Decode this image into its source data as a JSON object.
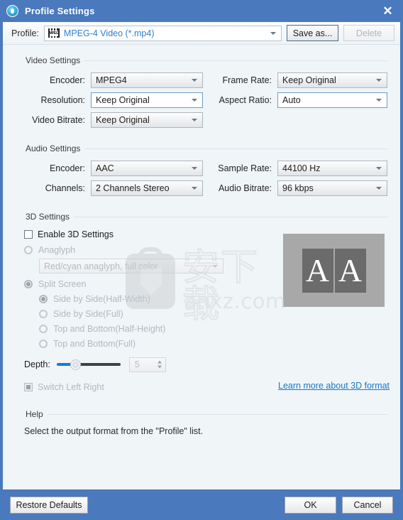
{
  "window": {
    "title": "Profile Settings",
    "app_icon": "profile-circle-icon",
    "close_icon": "✕",
    "titlebar_color": "#4a79bd",
    "background_color": "#f0f5f8"
  },
  "profile_bar": {
    "label": "Profile:",
    "format_icon": "mpeg-film-icon",
    "selected_profile": "MPEG-4 Video (*.mp4)",
    "save_as_label": "Save as...",
    "delete_label": "Delete",
    "delete_enabled": false
  },
  "video_settings": {
    "title": "Video Settings",
    "fields": [
      {
        "label": "Encoder:",
        "value": "MPEG4",
        "style": "flat"
      },
      {
        "label": "Resolution:",
        "value": "Keep Original",
        "style": "editable"
      },
      {
        "label": "Video Bitrate:",
        "value": "Keep Original",
        "style": "flat"
      }
    ],
    "fields_right": [
      {
        "label": "Frame Rate:",
        "value": "Keep Original",
        "style": "flat"
      },
      {
        "label": "Aspect Ratio:",
        "value": "Auto",
        "style": "editable"
      }
    ]
  },
  "audio_settings": {
    "title": "Audio Settings",
    "fields": [
      {
        "label": "Encoder:",
        "value": "AAC",
        "style": "flat"
      },
      {
        "label": "Channels:",
        "value": "2 Channels Stereo",
        "style": "flat"
      }
    ],
    "fields_right": [
      {
        "label": "Sample Rate:",
        "value": "44100 Hz",
        "style": "flat"
      },
      {
        "label": "Audio Bitrate:",
        "value": "96 kbps",
        "style": "flat"
      }
    ]
  },
  "three_d_settings": {
    "title": "3D Settings",
    "enable_label": "Enable 3D Settings",
    "enabled": false,
    "anaglyph_label": "Anaglyph",
    "anaglyph_selected": false,
    "anaglyph_value": "Red/cyan anaglyph, full color",
    "split_screen_label": "Split Screen",
    "split_screen_selected": true,
    "split_options": [
      {
        "label": "Side by Side(Half-Width)",
        "selected": true
      },
      {
        "label": "Side by Side(Full)",
        "selected": false
      },
      {
        "label": "Top and Bottom(Half-Height)",
        "selected": false
      },
      {
        "label": "Top and Bottom(Full)",
        "selected": false
      }
    ],
    "depth_label": "Depth:",
    "depth_value": "5",
    "switch_left_right_label": "Switch Left Right",
    "learn_more_label": "Learn more about 3D format",
    "preview_letter_left": "A",
    "preview_letter_right": "A"
  },
  "help": {
    "title": "Help",
    "text": "Select the output format from the \"Profile\" list."
  },
  "footer": {
    "restore_defaults_label": "Restore Defaults",
    "ok_label": "OK",
    "cancel_label": "Cancel"
  },
  "watermark": {
    "chinese_text": "安下载",
    "domain_text": "anxz.com"
  }
}
